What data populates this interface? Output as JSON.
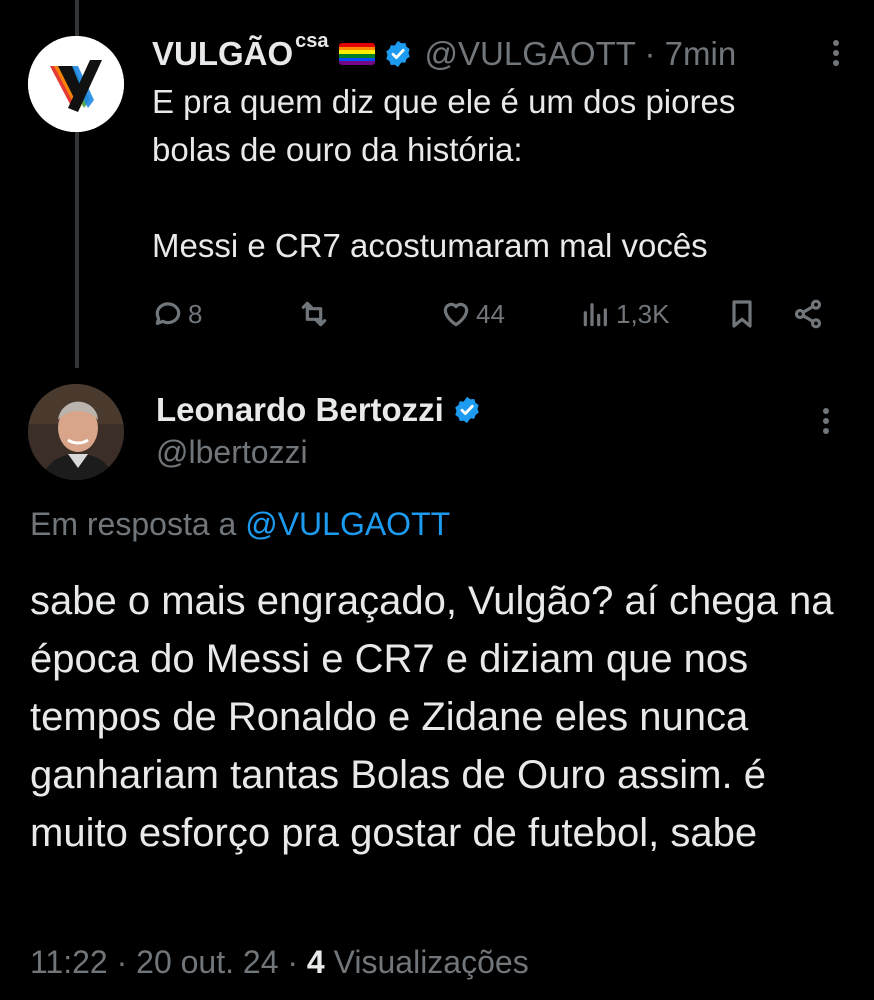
{
  "original_tweet": {
    "author_name": "VULGÃO",
    "author_name_suffix": "csa",
    "handle": "@VULGAOTT",
    "time": "7min",
    "separator": "·",
    "text": "E pra quem diz que ele é um dos piores\nbolas de ouro da história:\n\nMessi e CR7 acostumaram mal vocês",
    "actions": {
      "replies": "8",
      "reposts": "",
      "likes": "44",
      "views": "1,3K"
    }
  },
  "reply_tweet": {
    "author_name": "Leonardo Bertozzi",
    "handle": "@lbertozzi",
    "reply_prefix": "Em resposta a",
    "reply_to_handle": "@VULGAOTT",
    "text": "sabe o mais engraçado, Vulgão? aí chega na época do Messi e CR7 e diziam que nos tempos de Ronaldo e Zidane eles nunca ganhariam tantas Bolas de Ouro assim. é muito esforço pra gostar de futebol, sabe",
    "time": "11:22",
    "date": "20 out. 24",
    "views_count": "4",
    "views_label": "Visualizações",
    "separator": "·"
  },
  "colors": {
    "background": "#000000",
    "text": "#e7e9ea",
    "muted": "#71767b",
    "accent": "#1d9bf0",
    "thread_line": "#333639"
  },
  "icons": [
    "reply-icon",
    "repost-icon",
    "like-icon",
    "views-icon",
    "bookmark-icon",
    "share-icon",
    "verified-badge-icon",
    "more-icon",
    "rainbow-flag-icon"
  ]
}
